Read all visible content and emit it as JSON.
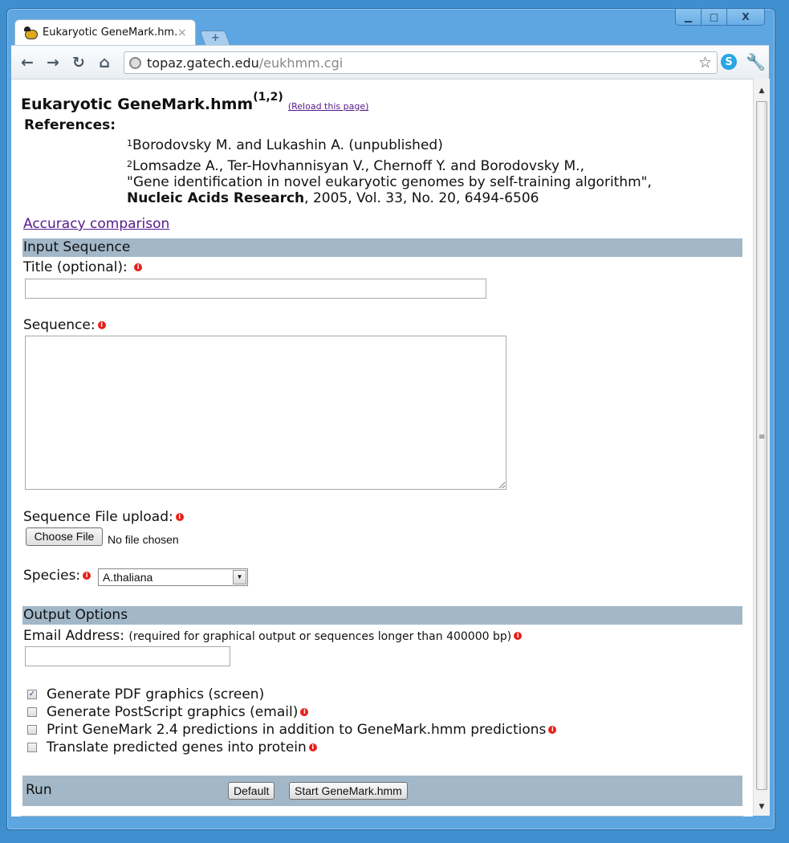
{
  "browser": {
    "tab_title": "Eukaryotic GeneMark.hm...",
    "tab_close": "×",
    "new_tab": "+",
    "url_host": "topaz.gatech.edu",
    "url_path": "/eukhmm.cgi",
    "nav": {
      "back": "←",
      "forward": "→",
      "reload": "↻",
      "home": "⌂"
    },
    "star": "☆",
    "skype": "S",
    "wrench": "🔧",
    "window_controls": {
      "minimize": "▁",
      "maximize": "□",
      "close": "X"
    },
    "scroll_up": "▲",
    "scroll_down": "▼"
  },
  "page": {
    "title": "Eukaryotic GeneMark.hmm",
    "title_sup": "(1,2)",
    "reload_link": "(Reload this page)",
    "references_label": "References:",
    "ref1_sup": "1",
    "ref1": "Borodovsky M. and Lukashin A. (unpublished)",
    "ref2_sup": "2",
    "ref2_line1": "Lomsadze A., Ter-Hovhannisyan V., Chernoff Y. and Borodovsky M.,",
    "ref2_line2": "\"Gene identification in novel eukaryotic genomes by self-training algorithm\",",
    "ref2_journal": "Nucleic Acids Research",
    "ref2_rest": ", 2005, Vol. 33, No. 20, 6494-6506",
    "accuracy_link": "Accuracy comparison",
    "info_glyph": "i"
  },
  "input_section": {
    "header": "Input Sequence",
    "title_label": "Title (optional):",
    "title_value": "",
    "sequence_label": "Sequence:",
    "sequence_value": "",
    "file_label": "Sequence File upload:",
    "choose_file": "Choose File",
    "no_file": "No file chosen",
    "species_label": "Species:",
    "species_selected": "A.thaliana",
    "select_arrow": "▼"
  },
  "output_section": {
    "header": "Output Options",
    "email_label": "Email Address:",
    "email_note": "(required for graphical output or sequences longer than 400000 bp)",
    "email_value": "",
    "options": [
      {
        "label": "Generate PDF graphics (screen)",
        "checked": true,
        "check": "✓"
      },
      {
        "label": "Generate PostScript graphics (email)",
        "checked": false,
        "check": ""
      },
      {
        "label": "Print GeneMark 2.4 predictions in addition to GeneMark.hmm predictions",
        "checked": false,
        "check": ""
      },
      {
        "label": "Translate predicted genes into protein",
        "checked": false,
        "check": ""
      }
    ]
  },
  "run_section": {
    "label": "Run",
    "default_button": "Default",
    "start_button": "Start GeneMark.hmm"
  }
}
